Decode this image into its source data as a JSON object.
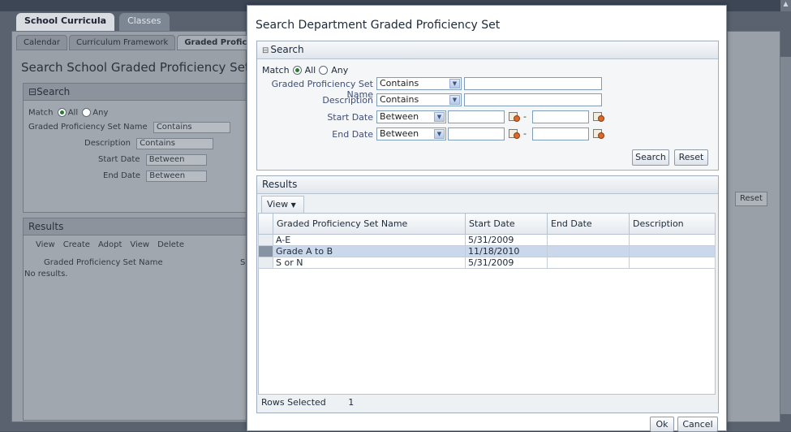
{
  "background": {
    "top_tabs": [
      "School Curricula",
      "Classes"
    ],
    "sub_tabs": [
      "Calendar",
      "Curriculum Framework",
      "Graded Proficier"
    ],
    "page_title": "Search School Graded Proficiency Set",
    "search_header": "Search",
    "match_label": "Match",
    "match_all": "All",
    "match_any": "Any",
    "fields": [
      {
        "label": "Graded Proficiency Set Name",
        "operator": "Contains"
      },
      {
        "label": "Description",
        "operator": "Contains"
      },
      {
        "label": "Start Date",
        "operator": "Between"
      },
      {
        "label": "End Date",
        "operator": "Between"
      }
    ],
    "results_header": "Results",
    "toolbar": [
      "View",
      "Create",
      "Adopt",
      "View",
      "Delete"
    ],
    "column_header": "Graded Proficiency Set Name",
    "column_header_s": "S",
    "no_results": "No results.",
    "reset_label": "Reset"
  },
  "modal": {
    "title": "Search Department Graded Proficiency Set",
    "search": {
      "header": "Search",
      "toggle": "⊟",
      "match_label": "Match",
      "match_all": "All",
      "match_any": "Any",
      "match_selected": "All",
      "fields": {
        "name": {
          "label": "Graded Proficiency Set Name",
          "operator": "Contains",
          "value": ""
        },
        "description": {
          "label": "Description",
          "operator": "Contains",
          "value": ""
        },
        "start_date": {
          "label": "Start Date",
          "operator": "Between",
          "from": "",
          "to": ""
        },
        "end_date": {
          "label": "End Date",
          "operator": "Between",
          "from": "",
          "to": ""
        }
      },
      "search_button": "Search",
      "reset_button": "Reset"
    },
    "results": {
      "header": "Results",
      "view_menu": "View",
      "columns": [
        "Graded Proficiency Set Name",
        "Start Date",
        "End Date",
        "Description"
      ],
      "rows": [
        {
          "name": "A-E",
          "start": "5/31/2009",
          "end": "",
          "description": "",
          "selected": false
        },
        {
          "name": "Grade A to B",
          "start": "11/18/2010",
          "end": "",
          "description": "",
          "selected": true
        },
        {
          "name": "S or N",
          "start": "5/31/2009",
          "end": "",
          "description": "",
          "selected": false
        }
      ],
      "rows_selected_label": "Rows Selected",
      "rows_selected_count": "1"
    },
    "ok_button": "Ok",
    "cancel_button": "Cancel"
  }
}
